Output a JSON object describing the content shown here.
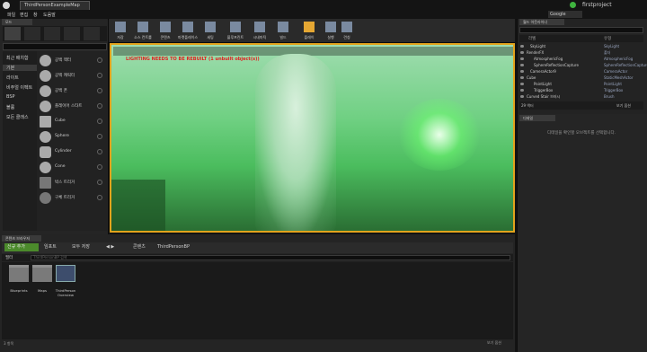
{
  "window": {
    "doc_tab": "ThirdPersonExampleMap",
    "project_name": "firstproject",
    "google_search": "Google"
  },
  "menu": [
    "파일",
    "편집",
    "창",
    "도움말"
  ],
  "modes": {
    "tab": "모드",
    "categories": [
      "최근 배치함",
      "기본",
      "라이트",
      "비주얼 이펙트",
      "BSP",
      "볼륨",
      "모든 클래스"
    ],
    "items": [
      "공백 액터",
      "공백 캐릭터",
      "공백 폰",
      "플레이어 스타트",
      "Cube",
      "Sphere",
      "Cylinder",
      "Cone",
      "박스 트리거",
      "구체 트리거"
    ]
  },
  "toolbar": {
    "buttons": [
      "저장",
      "소스 컨트롤",
      "콘텐츠",
      "마켓플레이스",
      "세팅",
      "블루프린트",
      "시네마틱",
      "빌드",
      "플레이",
      "실행",
      "런칭"
    ]
  },
  "viewport": {
    "warning": "LIGHTING NEEDS TO BE REBUILT (1 unbuilt object(s))"
  },
  "outliner": {
    "tab": "월드 아웃라이너",
    "headers": [
      "라벨",
      "유형"
    ],
    "rows": [
      {
        "name": "SkyLight",
        "type": "SkyLight",
        "indent": 12
      },
      {
        "name": "RenderFX",
        "type": "폴더",
        "indent": 8
      },
      {
        "name": "AtmosphericFog",
        "type": "AtmosphericFog",
        "indent": 16
      },
      {
        "name": "SphereReflectionCapture",
        "type": "SphereReflectionCapture",
        "indent": 16
      },
      {
        "name": "CameraActor9",
        "type": "CameraActor",
        "indent": 12
      },
      {
        "name": "Cube",
        "type": "StaticMeshActor",
        "indent": 8
      },
      {
        "name": "PointLight",
        "type": "PointLight",
        "indent": 16
      },
      {
        "name": "TriggerBox",
        "type": "TriggerBox",
        "indent": 16
      },
      {
        "name": "Curved Stair 브러시",
        "type": "Brush",
        "indent": 8
      }
    ],
    "footer_count": "29 액터",
    "view_options": "보기 옵션"
  },
  "details": {
    "tab": "디테일",
    "message": "디테일을 확인할 오브젝트를 선택합니다."
  },
  "content_browser": {
    "tab": "콘텐츠 브라우저",
    "add_new": "신규 추가",
    "import": "임포트",
    "save_all": "모두 저장",
    "path_root": "콘텐츠",
    "path_folder": "ThirdPersonBP",
    "filters": "필터",
    "search_placeholder": "ThirdPersonBP 검색",
    "assets": [
      {
        "label": "Blueprints",
        "kind": "folder"
      },
      {
        "label": "Maps",
        "kind": "folder"
      },
      {
        "label": "ThirdPerson Overview",
        "kind": "doc"
      }
    ],
    "status": "3 항목",
    "view_options": "보기 옵션"
  }
}
